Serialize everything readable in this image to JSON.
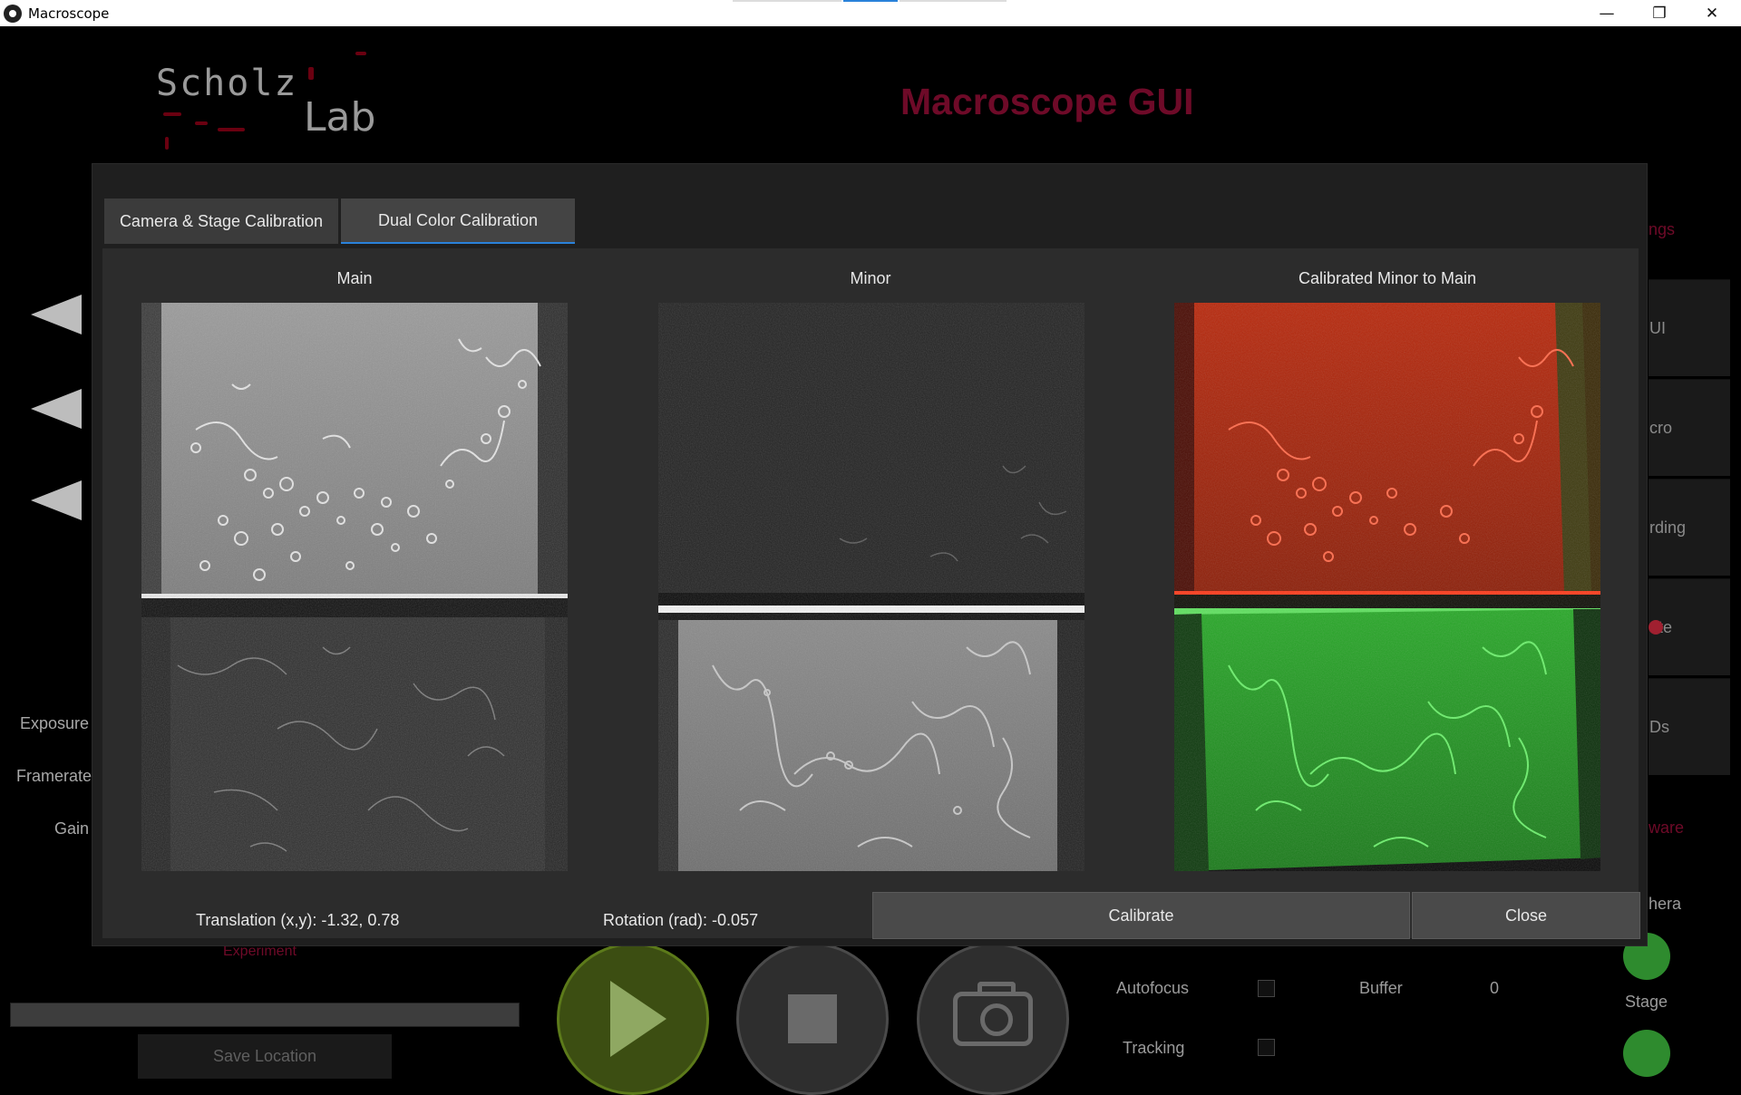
{
  "window": {
    "title": "Macroscope",
    "minimize_glyph": "—",
    "maximize_glyph": "❐",
    "close_glyph": "✕"
  },
  "background": {
    "logo_line1": "Scholz",
    "logo_line2": "Lab",
    "app_title": "Macroscope GUI",
    "param_labels": [
      "Exposure",
      "Framerate",
      "Gain"
    ],
    "side_tabs": [
      "UI",
      "cro",
      "rding",
      "ate",
      "Ds"
    ],
    "red_labels": {
      "settings_partial": "ngs",
      "hardware_partial": "ware",
      "experiment": "Experiment"
    },
    "status_labels": {
      "camera_partial": "hera",
      "stage": "Stage"
    },
    "save_location": "Save Location",
    "autofocus_label": "Autofocus",
    "tracking_label": "Tracking",
    "buffer_label": "Buffer",
    "buffer_value": "0",
    "colors": {
      "accent_red": "#6e0a28",
      "play_green": "#3c4e12",
      "status_green": "#2e8b2e"
    }
  },
  "dialog": {
    "tabs": [
      {
        "label": "Camera & Stage Calibration",
        "active": false
      },
      {
        "label": "Dual Color Calibration",
        "active": true
      }
    ],
    "panels": {
      "main_title": "Main",
      "minor_title": "Minor",
      "calibrated_title": "Calibrated Minor to Main"
    },
    "translation_text": "Translation (x,y): -1.32, 0.78",
    "rotation_text": "Rotation (rad): -0.057",
    "calibrate_label": "Calibrate",
    "close_label": "Close",
    "colors": {
      "tab_accent": "#2a82da",
      "overlay_red": "#c0200c",
      "overlay_green": "#1f9a1f"
    }
  }
}
